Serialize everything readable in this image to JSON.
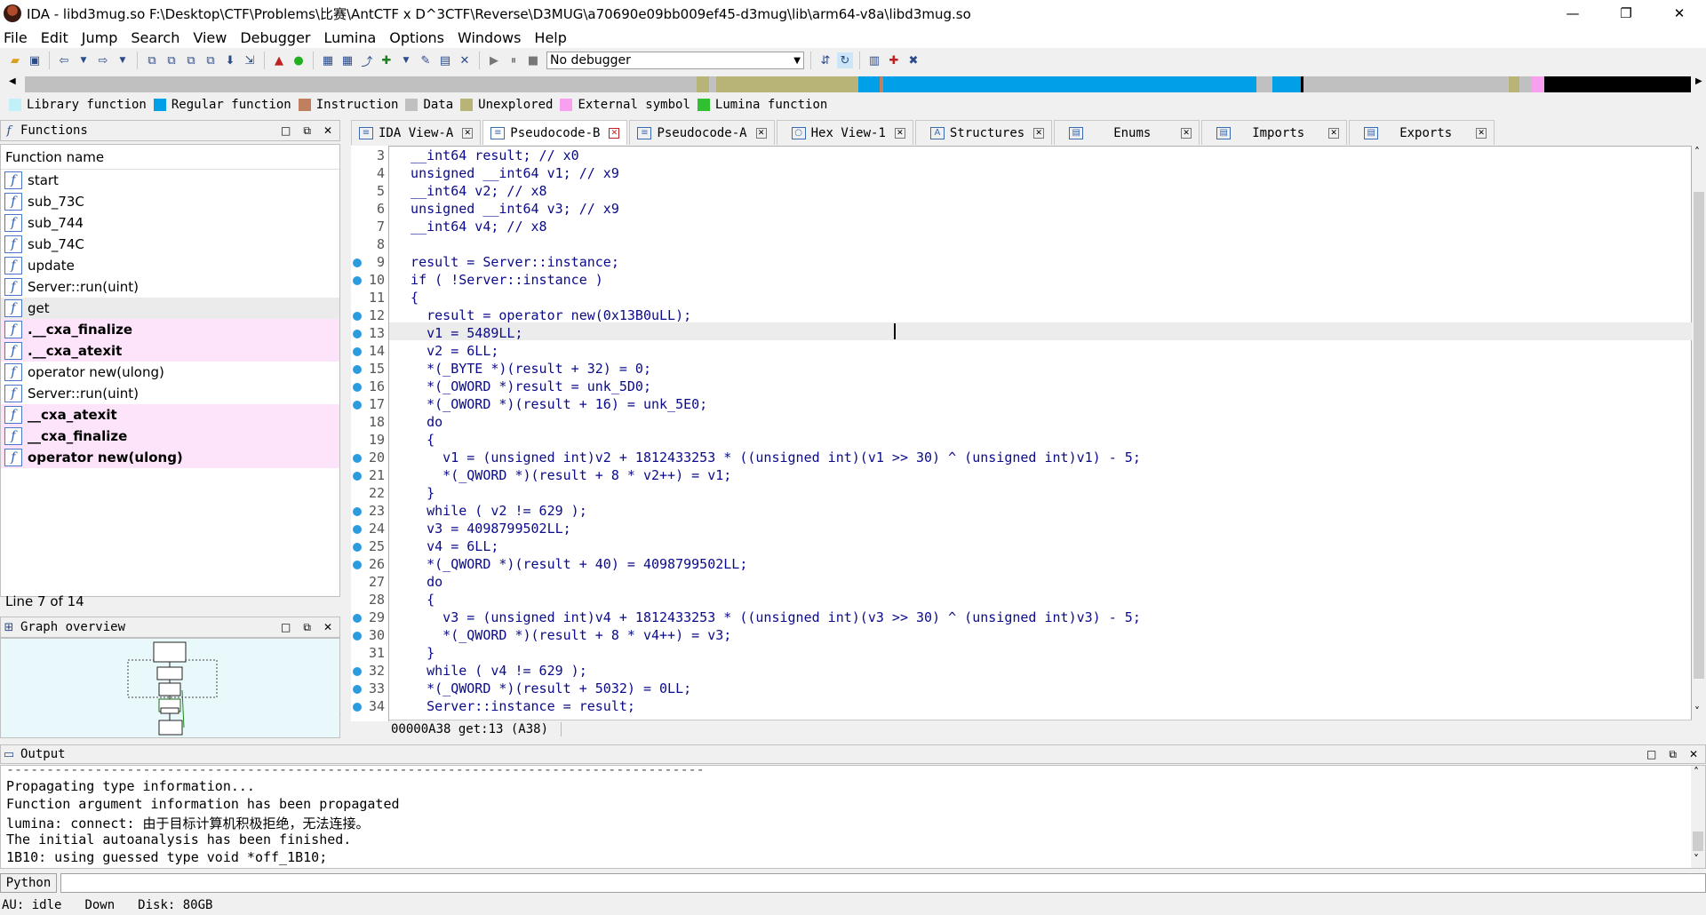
{
  "window": {
    "title": "IDA - libd3mug.so F:\\Desktop\\CTF\\Problems\\比赛\\AntCTF x D^3CTF\\Reverse\\D3MUG\\a70690e09bb009ef45-d3mug\\lib\\arm64-v8a\\libd3mug.so",
    "minimize": "—",
    "restore": "❐",
    "close": "✕"
  },
  "menu": [
    "File",
    "Edit",
    "Jump",
    "Search",
    "View",
    "Debugger",
    "Lumina",
    "Options",
    "Windows",
    "Help"
  ],
  "toolbar": {
    "debugger": "No debugger"
  },
  "legend": [
    {
      "label": "Library function",
      "color": "#c0f0f8"
    },
    {
      "label": "Regular function",
      "color": "#00a0e8"
    },
    {
      "label": "Instruction",
      "color": "#c08060"
    },
    {
      "label": "Data",
      "color": "#c0c0c0"
    },
    {
      "label": "Unexplored",
      "color": "#b8b478"
    },
    {
      "label": "External symbol",
      "color": "#f8a0f0"
    },
    {
      "label": "Lumina function",
      "color": "#30c030"
    }
  ],
  "functions": {
    "panel_title": "Functions",
    "column": "Function name",
    "items": [
      {
        "name": "start",
        "style": "normal"
      },
      {
        "name": "sub_73C",
        "style": "normal"
      },
      {
        "name": "sub_744",
        "style": "normal"
      },
      {
        "name": "sub_74C",
        "style": "normal"
      },
      {
        "name": "update",
        "style": "normal"
      },
      {
        "name": "Server::run(uint)",
        "style": "normal"
      },
      {
        "name": "get",
        "style": "sel"
      },
      {
        "name": ".__cxa_finalize",
        "style": "pink"
      },
      {
        "name": ".__cxa_atexit",
        "style": "pink"
      },
      {
        "name": "operator new(ulong)",
        "style": "normal"
      },
      {
        "name": "Server::run(uint)",
        "style": "normal"
      },
      {
        "name": "__cxa_atexit",
        "style": "pink"
      },
      {
        "name": "__cxa_finalize",
        "style": "pink"
      },
      {
        "name": "operator new(ulong)",
        "style": "pink"
      }
    ],
    "line_status": "Line 7 of 14"
  },
  "graph": {
    "panel_title": "Graph overview"
  },
  "tabs": [
    {
      "label": "IDA View-A",
      "active": false
    },
    {
      "label": "Pseudocode-B",
      "active": true
    },
    {
      "label": "Pseudocode-A",
      "active": false
    },
    {
      "label": "Hex View-1",
      "active": false
    },
    {
      "label": "Structures",
      "active": false
    },
    {
      "label": "Enums",
      "active": false
    },
    {
      "label": "Imports",
      "active": false
    },
    {
      "label": "Exports",
      "active": false
    }
  ],
  "code": {
    "lines": [
      {
        "n": "3",
        "dot": false,
        "text": "  __int64 result; // x0"
      },
      {
        "n": "4",
        "dot": false,
        "text": "  unsigned __int64 v1; // x9"
      },
      {
        "n": "5",
        "dot": false,
        "text": "  __int64 v2; // x8"
      },
      {
        "n": "6",
        "dot": false,
        "text": "  unsigned __int64 v3; // x9"
      },
      {
        "n": "7",
        "dot": false,
        "text": "  __int64 v4; // x8"
      },
      {
        "n": "8",
        "dot": false,
        "text": ""
      },
      {
        "n": "9",
        "dot": true,
        "text": "  result = Server::instance;"
      },
      {
        "n": "10",
        "dot": true,
        "text": "  if ( !Server::instance )"
      },
      {
        "n": "11",
        "dot": false,
        "text": "  {"
      },
      {
        "n": "12",
        "dot": true,
        "text": "    result = operator new(0x13B0uLL);"
      },
      {
        "n": "13",
        "dot": true,
        "text": "    v1 = 5489LL;"
      },
      {
        "n": "14",
        "dot": true,
        "text": "    v2 = 6LL;"
      },
      {
        "n": "15",
        "dot": true,
        "text": "    *(_BYTE *)(result + 32) = 0;"
      },
      {
        "n": "16",
        "dot": true,
        "text": "    *(_OWORD *)result = unk_5D0;"
      },
      {
        "n": "17",
        "dot": true,
        "text": "    *(_OWORD *)(result + 16) = unk_5E0;"
      },
      {
        "n": "18",
        "dot": false,
        "text": "    do"
      },
      {
        "n": "19",
        "dot": false,
        "text": "    {"
      },
      {
        "n": "20",
        "dot": true,
        "text": "      v1 = (unsigned int)v2 + 1812433253 * ((unsigned int)(v1 >> 30) ^ (unsigned int)v1) - 5;"
      },
      {
        "n": "21",
        "dot": true,
        "text": "      *(_QWORD *)(result + 8 * v2++) = v1;"
      },
      {
        "n": "22",
        "dot": false,
        "text": "    }"
      },
      {
        "n": "23",
        "dot": true,
        "text": "    while ( v2 != 629 );"
      },
      {
        "n": "24",
        "dot": true,
        "text": "    v3 = 4098799502LL;"
      },
      {
        "n": "25",
        "dot": true,
        "text": "    v4 = 6LL;"
      },
      {
        "n": "26",
        "dot": true,
        "text": "    *(_QWORD *)(result + 40) = 4098799502LL;"
      },
      {
        "n": "27",
        "dot": false,
        "text": "    do"
      },
      {
        "n": "28",
        "dot": false,
        "text": "    {"
      },
      {
        "n": "29",
        "dot": true,
        "text": "      v3 = (unsigned int)v4 + 1812433253 * ((unsigned int)(v3 >> 30) ^ (unsigned int)v3) - 5;"
      },
      {
        "n": "30",
        "dot": true,
        "text": "      *(_QWORD *)(result + 8 * v4++) = v3;"
      },
      {
        "n": "31",
        "dot": false,
        "text": "    }"
      },
      {
        "n": "32",
        "dot": true,
        "text": "    while ( v4 != 629 );"
      },
      {
        "n": "33",
        "dot": true,
        "text": "    *(_QWORD *)(result + 5032) = 0LL;"
      },
      {
        "n": "34",
        "dot": true,
        "text": "    Server::instance = result;"
      }
    ],
    "status": "00000A38 get:13 (A38)"
  },
  "output": {
    "panel_title": "Output",
    "lines": [
      "---------------------------------------------------------------------------------------",
      "Propagating type information...",
      "Function argument information has been propagated",
      "lumina: connect: 由于目标计算机积极拒绝，无法连接。",
      "The initial autoanalysis has been finished.",
      "1B10: using guessed type void *off_1B10;"
    ]
  },
  "python_button": "Python",
  "statusbar": {
    "au": "AU:  idle",
    "dir": "Down",
    "disk": "Disk: 80GB"
  }
}
